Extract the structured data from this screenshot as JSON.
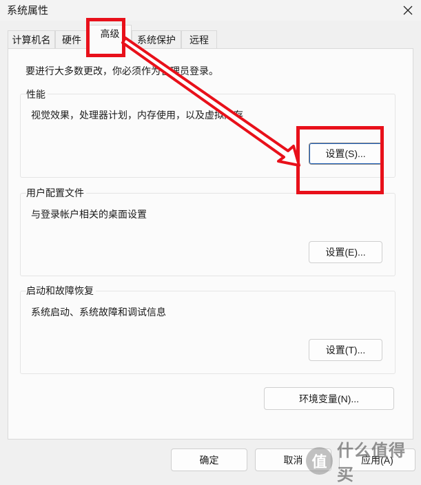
{
  "window": {
    "title": "系统属性"
  },
  "tabs": [
    {
      "label": "计算机名"
    },
    {
      "label": "硬件"
    },
    {
      "label": "高级",
      "active": true
    },
    {
      "label": "系统保护"
    },
    {
      "label": "远程"
    }
  ],
  "admin_note": "要进行大多数更改，你必须作为管理员登录。",
  "groups": {
    "performance": {
      "title": "性能",
      "description": "视觉效果，处理器计划，内存使用，以及虚拟内存",
      "button": "设置(S)..."
    },
    "user_profiles": {
      "title": "用户配置文件",
      "description": "与登录帐户相关的桌面设置",
      "button": "设置(E)..."
    },
    "startup_recovery": {
      "title": "启动和故障恢复",
      "description": "系统启动、系统故障和调试信息",
      "button": "设置(T)..."
    }
  },
  "env_button": "环境变量(N)...",
  "footer": {
    "ok": "确定",
    "cancel": "取消",
    "apply": "应用(A)"
  },
  "watermark": {
    "logo": "值",
    "text": "什么值得买"
  },
  "icons": {
    "close": "close-icon",
    "arrow": "red-arrow-annotation"
  },
  "colors": {
    "annotation": "#e8101a",
    "focus": "#1d5fb8",
    "background": "#f0f0f0"
  }
}
